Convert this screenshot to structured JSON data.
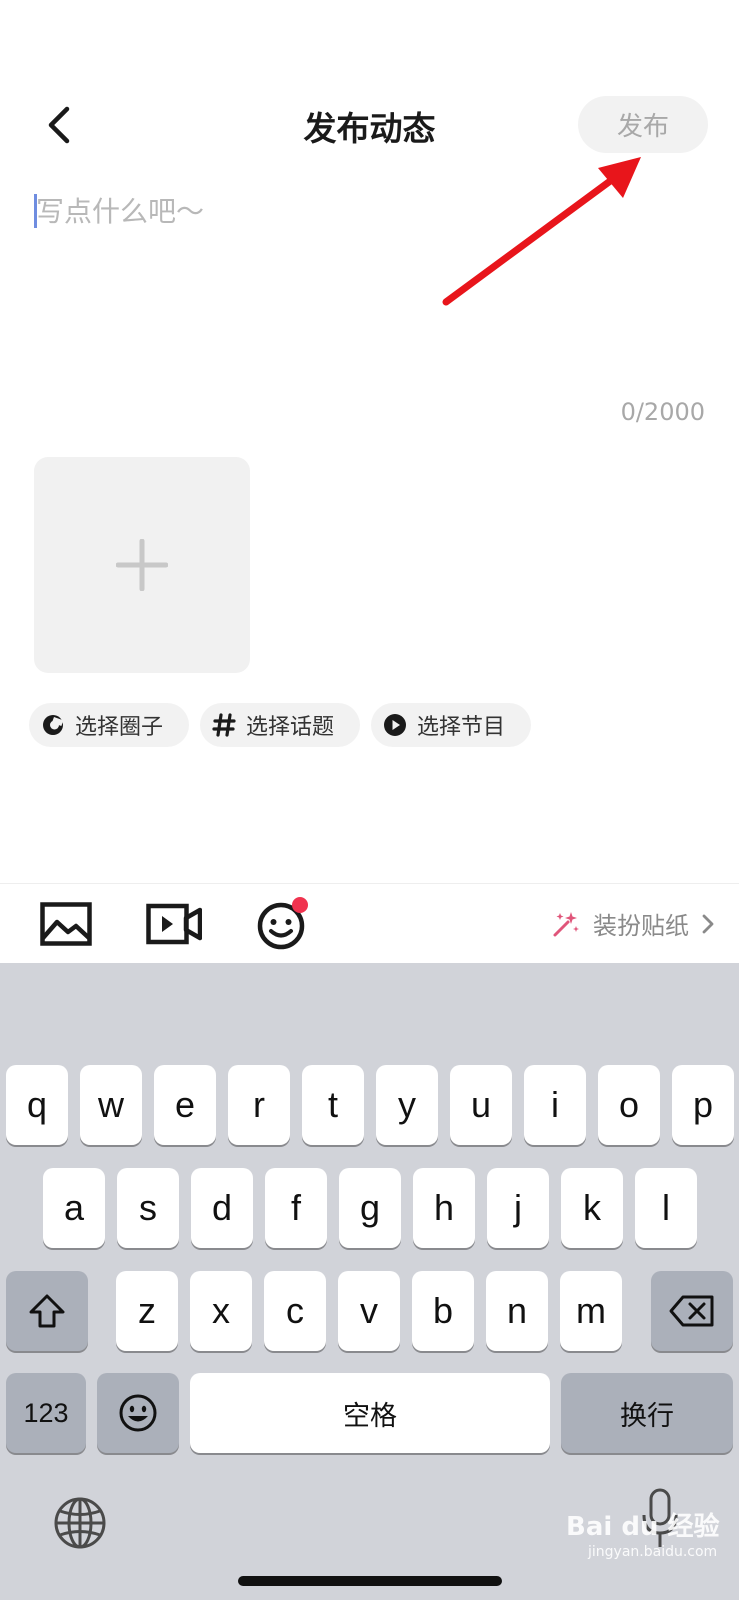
{
  "header": {
    "title": "发布动态",
    "publish_label": "发布"
  },
  "compose": {
    "placeholder": "写点什么吧～",
    "counter": "0/2000"
  },
  "chips": [
    {
      "label": "选择圈子",
      "icon": "circle-c-icon"
    },
    {
      "label": "选择话题",
      "icon": "hashtag-icon"
    },
    {
      "label": "选择节目",
      "icon": "play-circle-icon"
    }
  ],
  "toolbar": {
    "stickers_label": "装扮贴纸",
    "has_emoji_badge": true,
    "badge_color": "#f0334f"
  },
  "keyboard": {
    "row1": [
      "q",
      "w",
      "e",
      "r",
      "t",
      "y",
      "u",
      "i",
      "o",
      "p"
    ],
    "row2": [
      "a",
      "s",
      "d",
      "f",
      "g",
      "h",
      "j",
      "k",
      "l"
    ],
    "row3": [
      "z",
      "x",
      "c",
      "v",
      "b",
      "n",
      "m"
    ],
    "numbers_label": "123",
    "space_label": "空格",
    "return_label": "换行"
  },
  "watermark": {
    "text": "Bai du 经验",
    "sub": "jingyan.baidu.com"
  },
  "colors": {
    "arrow": "#e8151b",
    "placeholder": "#b8b8b8",
    "sticker_icon": "#e0557a"
  }
}
